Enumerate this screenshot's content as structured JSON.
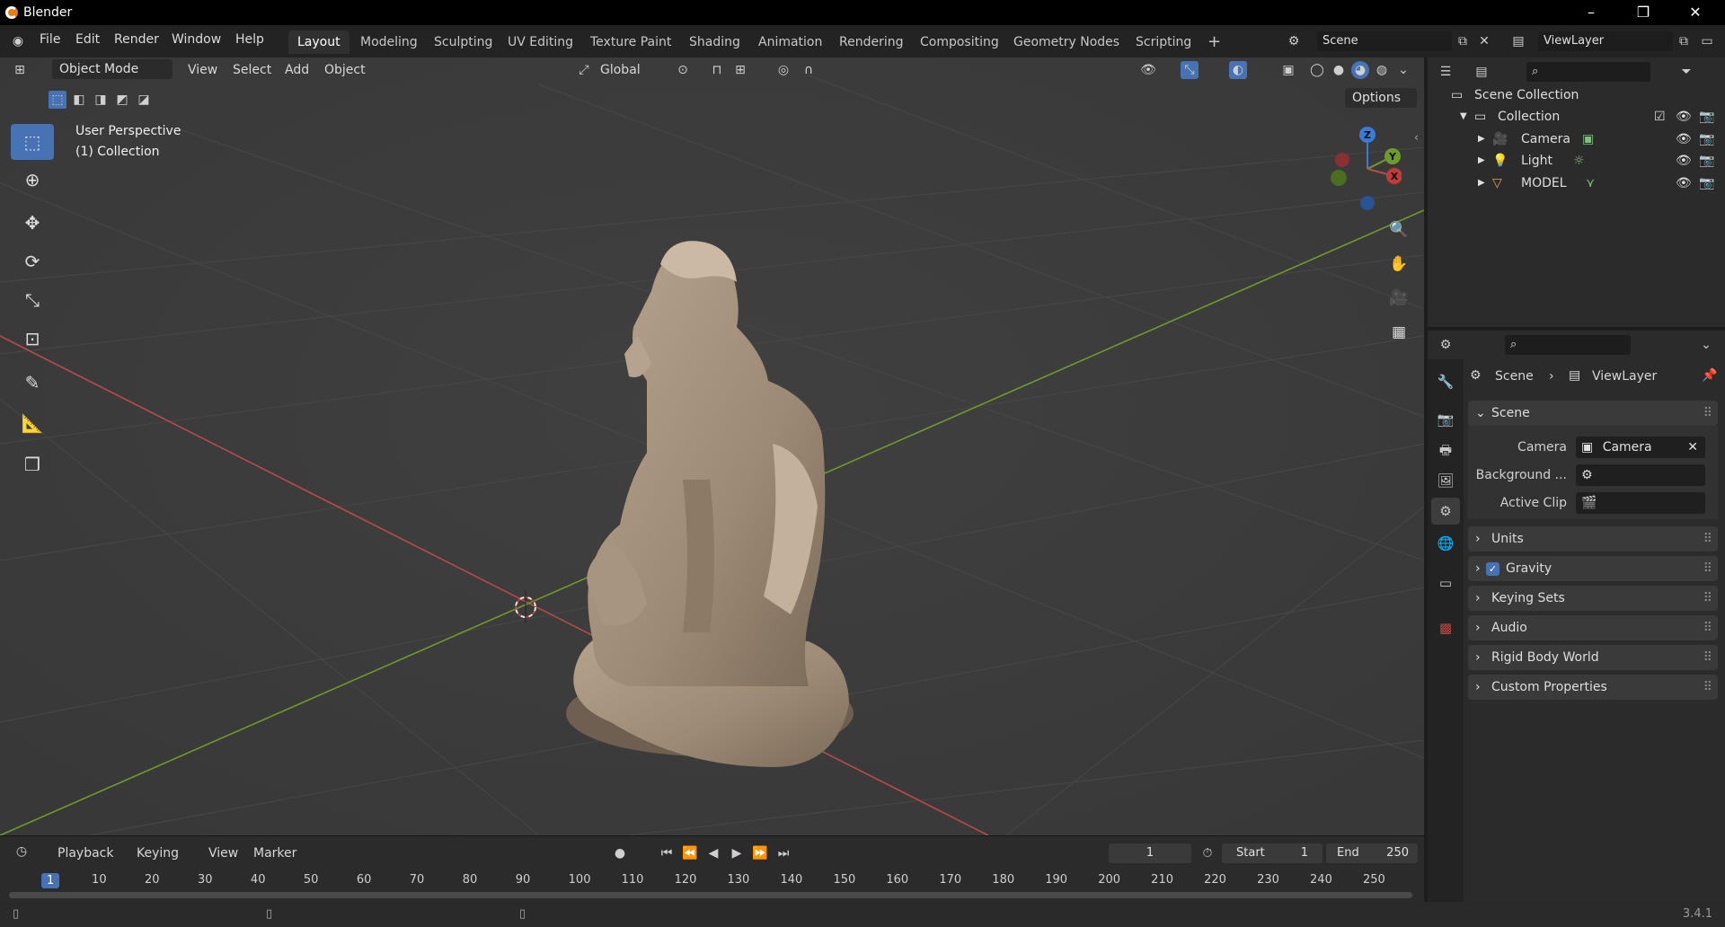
{
  "app": {
    "title": "Blender",
    "version": "3.4.1"
  },
  "menu": [
    "File",
    "Edit",
    "Render",
    "Window",
    "Help"
  ],
  "workspaces": [
    {
      "label": "Layout",
      "active": true
    },
    {
      "label": "Modeling"
    },
    {
      "label": "Sculpting"
    },
    {
      "label": "UV Editing"
    },
    {
      "label": "Texture Paint"
    },
    {
      "label": "Shading"
    },
    {
      "label": "Animation"
    },
    {
      "label": "Rendering"
    },
    {
      "label": "Compositing"
    },
    {
      "label": "Geometry Nodes"
    },
    {
      "label": "Scripting"
    }
  ],
  "add_workspace": "+",
  "scene_selector": "Scene",
  "viewlayer_selector": "ViewLayer",
  "viewport_header": {
    "mode": "Object Mode",
    "menus": [
      "View",
      "Select",
      "Add",
      "Object"
    ],
    "orientation": "Global",
    "options": "Options"
  },
  "viewport": {
    "perspective": "User Perspective",
    "collection": "(1) Collection",
    "gizmo_axes": {
      "z": "Z",
      "y": "Y",
      "x": "X"
    }
  },
  "outliner": {
    "root": "Scene Collection",
    "collection": "Collection",
    "items": [
      {
        "name": "Camera",
        "icon": "camera-icon"
      },
      {
        "name": "Light",
        "icon": "light-icon"
      },
      {
        "name": "MODEL",
        "icon": "mesh-icon"
      }
    ]
  },
  "properties": {
    "breadcrumb_scene": "Scene",
    "breadcrumb_viewlayer": "ViewLayer",
    "section": "Scene",
    "fields": [
      {
        "label": "Camera",
        "value": "Camera"
      },
      {
        "label": "Background ...",
        "value": ""
      },
      {
        "label": "Active Clip",
        "value": ""
      }
    ],
    "panels": [
      {
        "label": "Units",
        "checkbox": false
      },
      {
        "label": "Gravity",
        "checkbox": true
      },
      {
        "label": "Keying Sets",
        "checkbox": false
      },
      {
        "label": "Audio",
        "checkbox": false
      },
      {
        "label": "Rigid Body World",
        "checkbox": false
      },
      {
        "label": "Custom Properties",
        "checkbox": false
      }
    ]
  },
  "timeline": {
    "menus": [
      "Playback",
      "Keying",
      "View",
      "Marker"
    ],
    "current_frame": "1",
    "start_label": "Start",
    "start": "1",
    "end_label": "End",
    "end": "250",
    "ruler": [
      "1",
      "10",
      "20",
      "30",
      "40",
      "50",
      "60",
      "70",
      "80",
      "90",
      "100",
      "110",
      "120",
      "130",
      "140",
      "150",
      "160",
      "170",
      "180",
      "190",
      "200",
      "210",
      "220",
      "230",
      "240",
      "250"
    ]
  },
  "colors": {
    "accent": "#4772b3",
    "x_axis": "#b84a4a",
    "y_axis": "#6e9b2c",
    "z_axis": "#3b7ad6"
  }
}
